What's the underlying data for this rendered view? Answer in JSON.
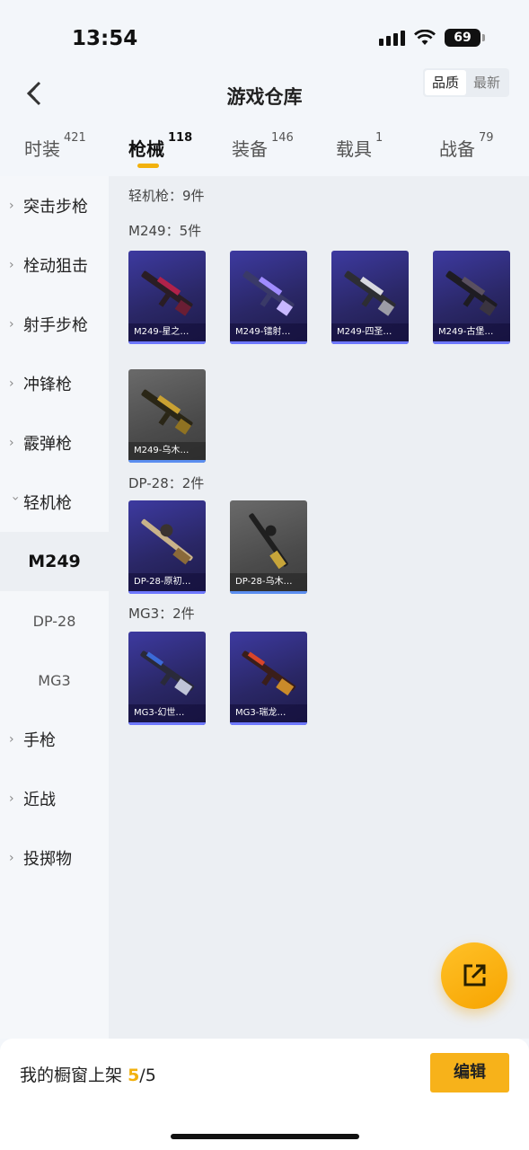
{
  "status": {
    "time": "13:54",
    "battery": "69"
  },
  "header": {
    "title": "游戏仓库",
    "sort_options": [
      "品质",
      "最新"
    ],
    "sort_active": "品质"
  },
  "tabs": [
    {
      "label": "时装",
      "count": "421"
    },
    {
      "label": "枪械",
      "count": "118"
    },
    {
      "label": "装备",
      "count": "146"
    },
    {
      "label": "载具",
      "count": "1"
    },
    {
      "label": "战备",
      "count": "79"
    }
  ],
  "active_tab": "枪械",
  "sidebar": {
    "categories": [
      {
        "label": "突击步枪"
      },
      {
        "label": "栓动狙击"
      },
      {
        "label": "射手步枪"
      },
      {
        "label": "冲锋枪"
      },
      {
        "label": "霰弹枪"
      },
      {
        "label": "轻机枪"
      },
      {
        "label": "手枪"
      },
      {
        "label": "近战"
      },
      {
        "label": "投掷物"
      }
    ],
    "sub_items": [
      {
        "label": "M249"
      },
      {
        "label": "DP-28"
      },
      {
        "label": "MG3"
      }
    ],
    "active_sub": "M249"
  },
  "main": {
    "group_title": "轻机枪：9件",
    "sections": [
      {
        "title": "M249：5件",
        "items": [
          "M249-星之…",
          "M249-镭射…",
          "M249-四圣…",
          "M249-古堡…",
          "M249-乌木…"
        ]
      },
      {
        "title": "DP-28：2件",
        "items": [
          "DP-28-原初…",
          "DP-28-乌木…"
        ]
      },
      {
        "title": "MG3：2件",
        "items": [
          "MG3-幻世…",
          "MG3-瑞龙…"
        ]
      }
    ]
  },
  "bottom": {
    "showcase_label": "我的橱窗上架",
    "showcase_current": "5",
    "showcase_total": "/5",
    "edit_label": "编辑"
  },
  "colors": {
    "accent": "#f7b21a",
    "card_purple": "#2a2766",
    "card_grey": "#4b4b4b"
  }
}
